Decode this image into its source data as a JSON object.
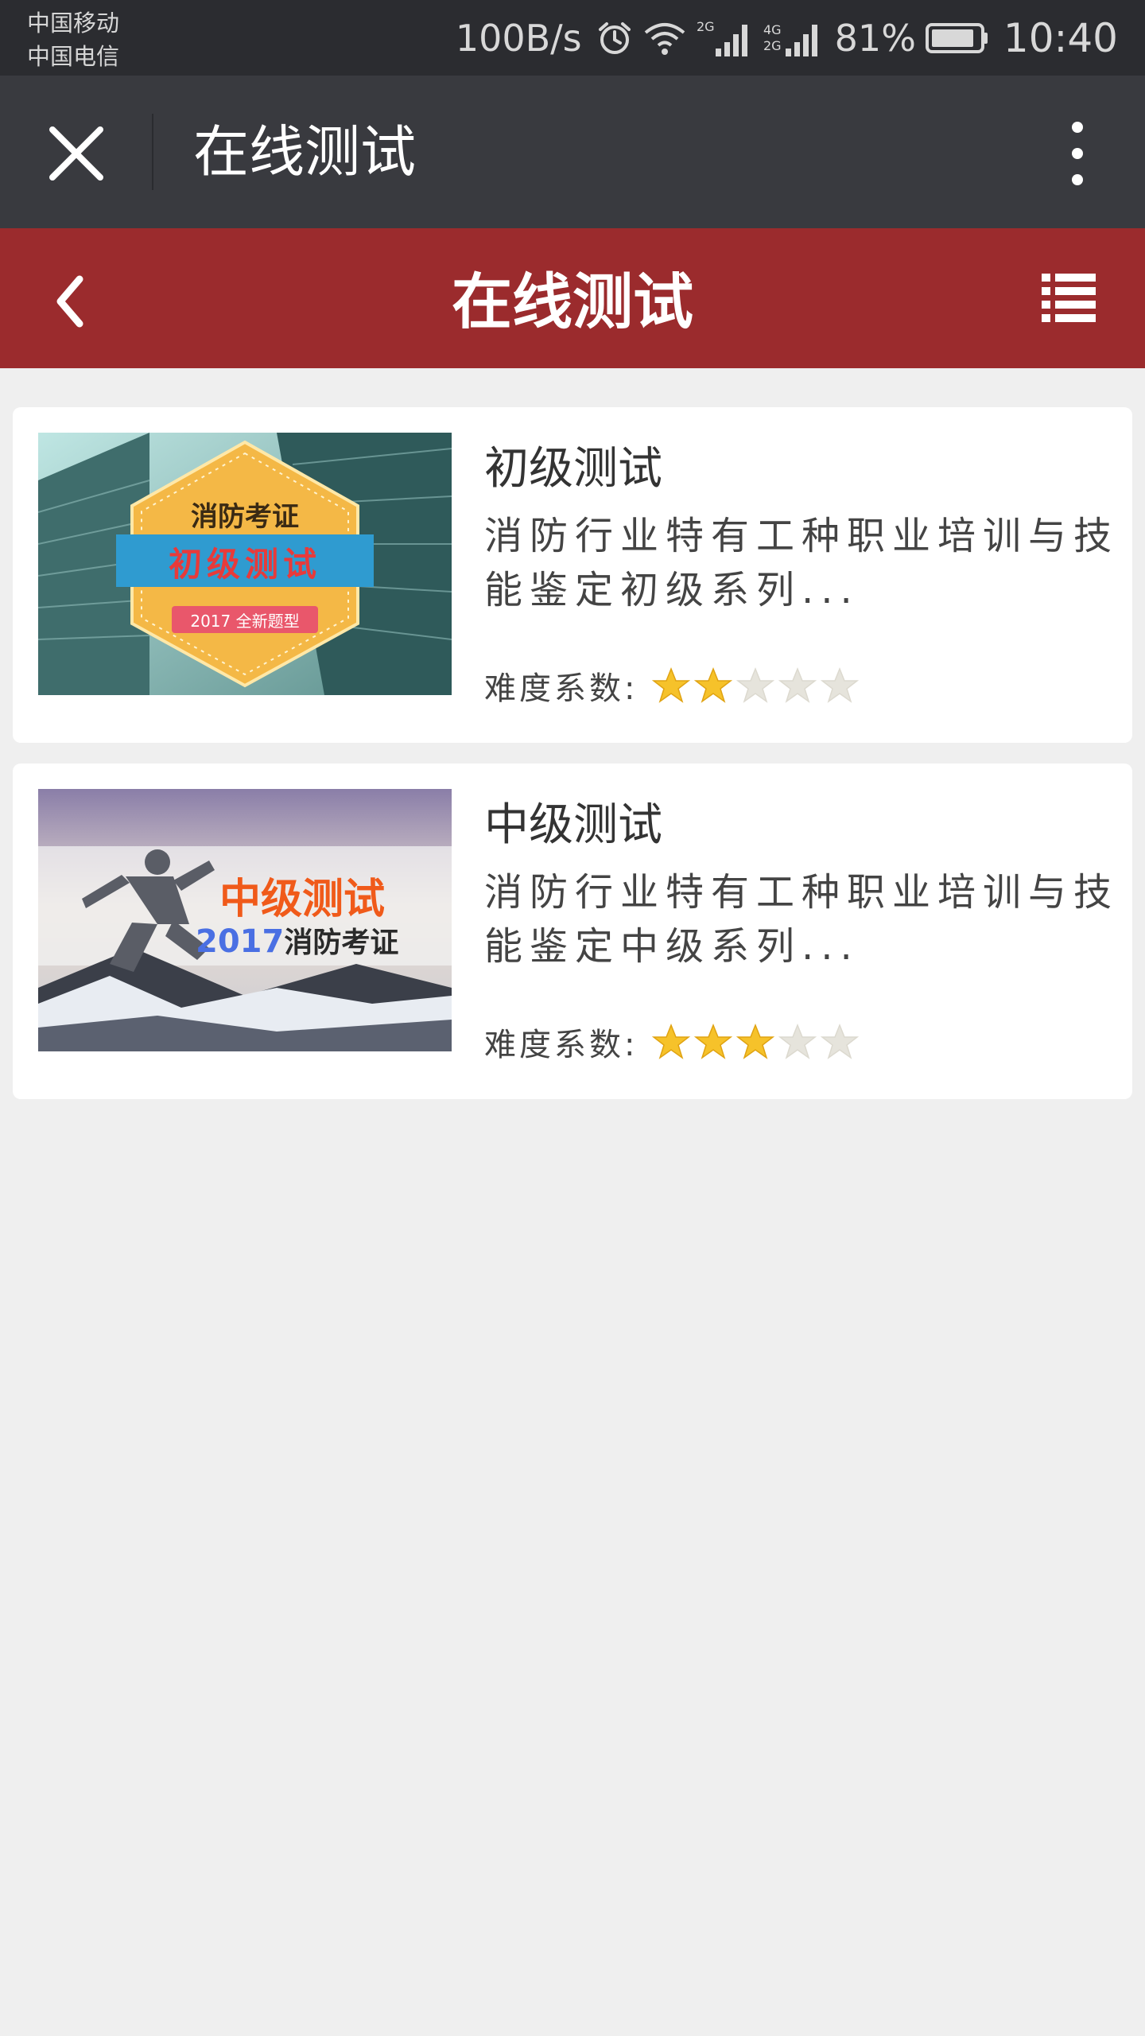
{
  "status_bar": {
    "carrier_1": "中国移动",
    "carrier_2": "中国电信",
    "speed": "100B/s",
    "battery": "81%",
    "time": "10:40"
  },
  "app_bar": {
    "title": "在线测试"
  },
  "header": {
    "title": "在线测试"
  },
  "tests": [
    {
      "title": "初级测试",
      "description": "消防行业特有工种职业培训与技能鉴定初级系列...",
      "difficulty_label": "难度系数:",
      "stars": 2,
      "max_stars": 5,
      "thumb": {
        "line1": "消防考证",
        "line2": "初级测试",
        "line3": "2017 全新题型"
      }
    },
    {
      "title": "中级测试",
      "description": "消防行业特有工种职业培训与技能鉴定中级系列...",
      "difficulty_label": "难度系数:",
      "stars": 3,
      "max_stars": 5,
      "thumb": {
        "line1": "中级测试",
        "line2_year": "2017",
        "line2_text": "消防考证"
      }
    }
  ],
  "colors": {
    "header_red": "#9b2b2d",
    "app_bar": "#393a3f",
    "status_bar": "#2b2c30",
    "star_on": "#f6c22a",
    "star_off": "#e6e4dc"
  },
  "icons": [
    "close-icon",
    "more-vert-icon",
    "back-chevron-icon",
    "list-icon",
    "alarm-icon",
    "wifi-icon",
    "signal-icon",
    "battery-icon",
    "star-icon"
  ]
}
